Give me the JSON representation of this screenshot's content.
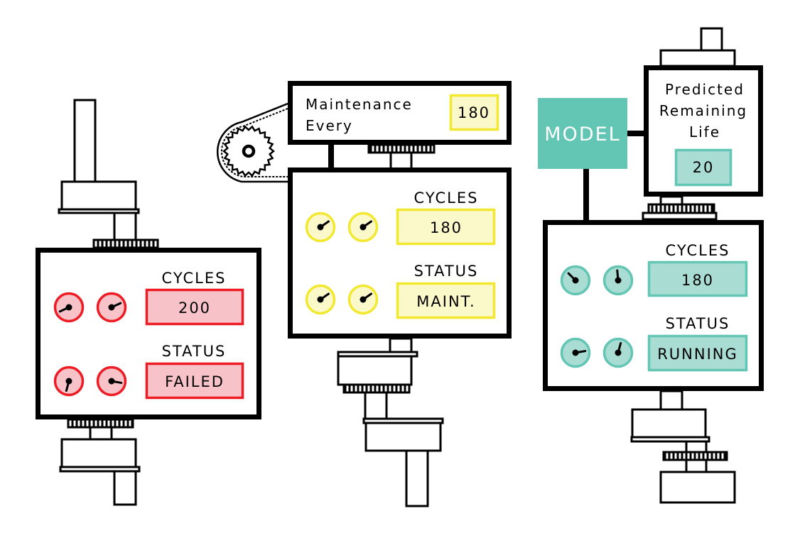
{
  "colors": {
    "failed_stroke": "#ee1c24",
    "failed_fill": "#f7c3c9",
    "maint_stroke": "#f2e830",
    "maint_fill": "#fbf8c9",
    "running_stroke": "#63c5b3",
    "running_fill": "#a9ddd3",
    "model_fill": "#63c5b3"
  },
  "machines": [
    {
      "cycles_label": "CYCLES",
      "cycles": "200",
      "status_label": "STATUS",
      "status": "FAILED",
      "gauge_needles_deg": [
        245,
        65,
        195,
        100
      ]
    },
    {
      "cycles_label": "CYCLES",
      "cycles": "180",
      "status_label": "STATUS",
      "status": "MAINT.",
      "gauge_needles_deg": [
        55,
        55,
        55,
        55
      ]
    },
    {
      "cycles_label": "CYCLES",
      "cycles": "180",
      "status_label": "STATUS",
      "status": "RUNNING",
      "gauge_needles_deg": [
        315,
        355,
        80,
        15
      ]
    }
  ],
  "maintenance": {
    "line1": "Maintenance",
    "line2": "Every",
    "value": "180"
  },
  "model": {
    "label": "MODEL"
  },
  "prediction": {
    "line1": "Predicted",
    "line2": "Remaining",
    "line3": "Life",
    "value": "20"
  }
}
